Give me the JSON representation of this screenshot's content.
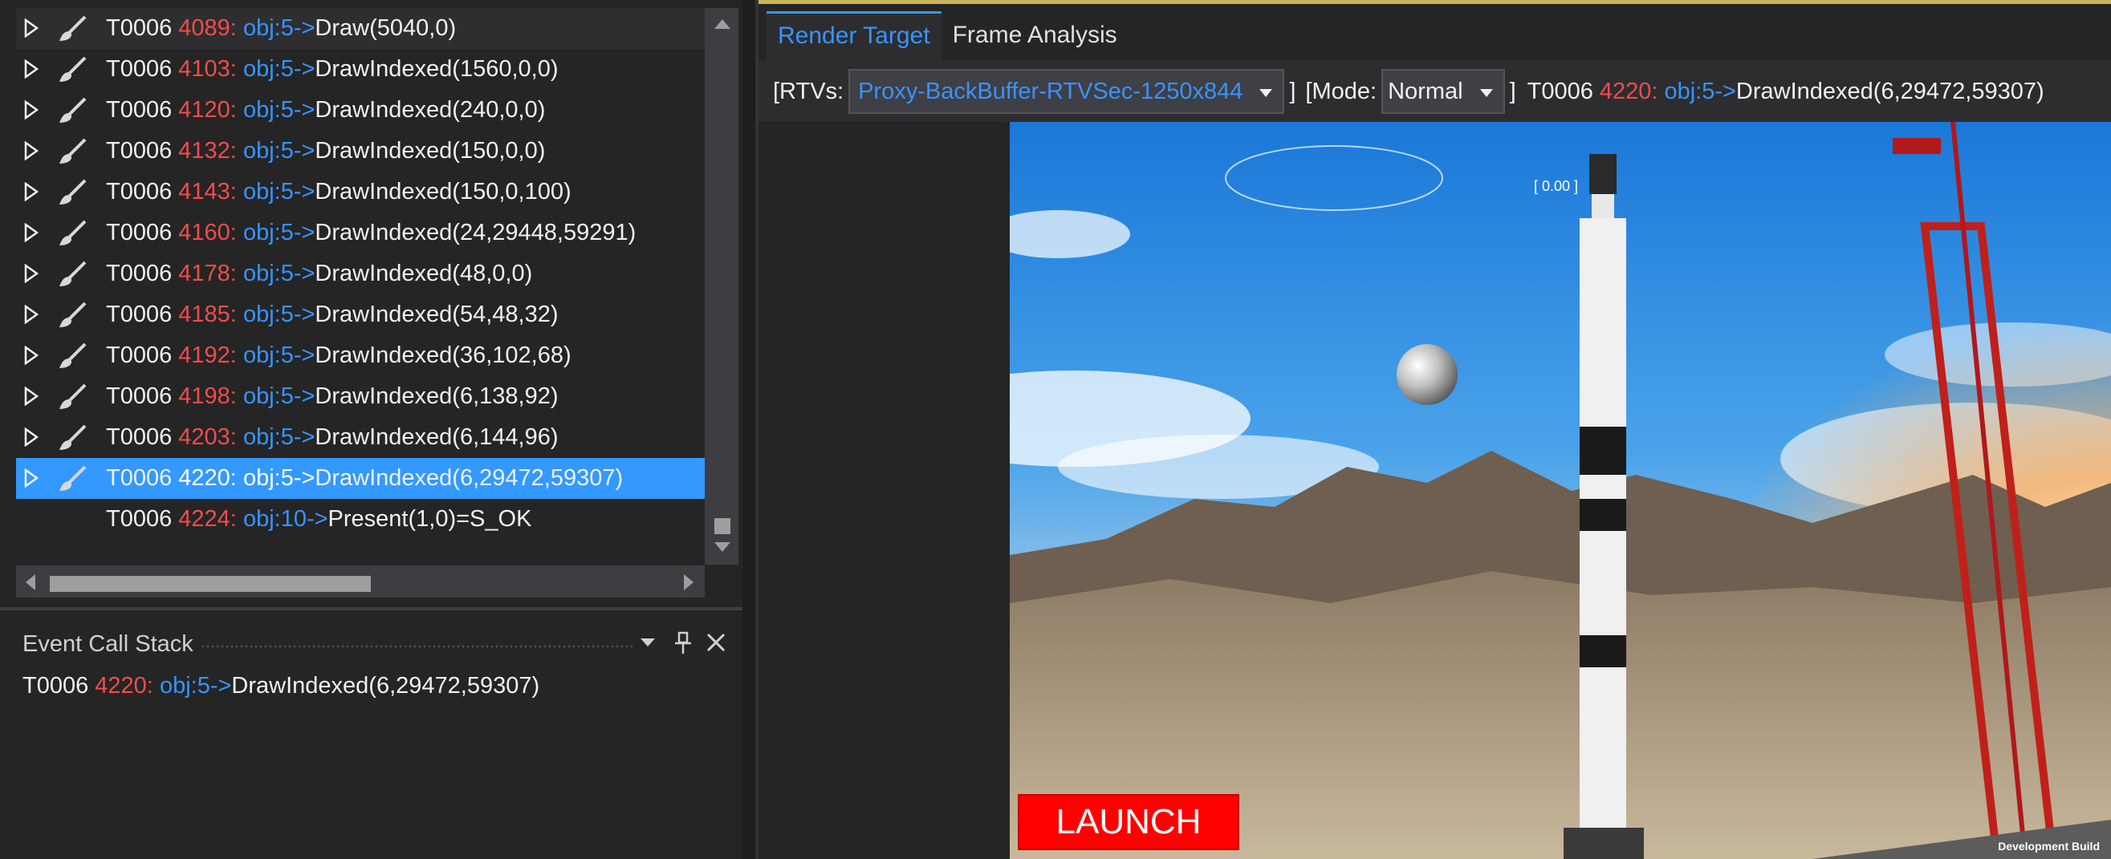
{
  "events": [
    {
      "thread": "T0006",
      "num": "4089:",
      "obj": "obj:5",
      "arrow": "->",
      "call": "Draw(5040,0)",
      "expandable": true,
      "icon": "brush-icon"
    },
    {
      "thread": "T0006",
      "num": "4103:",
      "obj": "obj:5",
      "arrow": "->",
      "call": "DrawIndexed(1560,0,0)",
      "expandable": true,
      "icon": "brush-icon"
    },
    {
      "thread": "T0006",
      "num": "4120:",
      "obj": "obj:5",
      "arrow": "->",
      "call": "DrawIndexed(240,0,0)",
      "expandable": true,
      "icon": "brush-icon"
    },
    {
      "thread": "T0006",
      "num": "4132:",
      "obj": "obj:5",
      "arrow": "->",
      "call": "DrawIndexed(150,0,0)",
      "expandable": true,
      "icon": "brush-icon"
    },
    {
      "thread": "T0006",
      "num": "4143:",
      "obj": "obj:5",
      "arrow": "->",
      "call": "DrawIndexed(150,0,100)",
      "expandable": true,
      "icon": "brush-icon"
    },
    {
      "thread": "T0006",
      "num": "4160:",
      "obj": "obj:5",
      "arrow": "->",
      "call": "DrawIndexed(24,29448,59291)",
      "expandable": true,
      "icon": "brush-icon"
    },
    {
      "thread": "T0006",
      "num": "4178:",
      "obj": "obj:5",
      "arrow": "->",
      "call": "DrawIndexed(48,0,0)",
      "expandable": true,
      "icon": "brush-icon"
    },
    {
      "thread": "T0006",
      "num": "4185:",
      "obj": "obj:5",
      "arrow": "->",
      "call": "DrawIndexed(54,48,32)",
      "expandable": true,
      "icon": "brush-icon"
    },
    {
      "thread": "T0006",
      "num": "4192:",
      "obj": "obj:5",
      "arrow": "->",
      "call": "DrawIndexed(36,102,68)",
      "expandable": true,
      "icon": "brush-icon"
    },
    {
      "thread": "T0006",
      "num": "4198:",
      "obj": "obj:5",
      "arrow": "->",
      "call": "DrawIndexed(6,138,92)",
      "expandable": true,
      "icon": "brush-icon"
    },
    {
      "thread": "T0006",
      "num": "4203:",
      "obj": "obj:5",
      "arrow": "->",
      "call": "DrawIndexed(6,144,96)",
      "expandable": true,
      "icon": "brush-icon"
    },
    {
      "thread": "T0006",
      "num": "4220:",
      "obj": "obj:5",
      "arrow": "->",
      "call": "DrawIndexed(6,29472,59307)",
      "expandable": true,
      "icon": "brush-icon",
      "selected": true
    },
    {
      "thread": "T0006",
      "num": "4224:",
      "obj": "obj:10",
      "arrow": "->",
      "call": "Present(1,0)=S_OK",
      "expandable": false,
      "icon": ""
    }
  ],
  "callstack": {
    "title": "Event Call Stack",
    "entry": {
      "thread": "T0006",
      "num": "4220:",
      "obj": "obj:5",
      "arrow": "->",
      "call": "DrawIndexed(6,29472,59307)"
    }
  },
  "tabs": [
    {
      "label": "Render Target",
      "active": true
    },
    {
      "label": "Frame Analysis",
      "active": false
    }
  ],
  "toolbar": {
    "rtvs_label": "[RTVs:",
    "rtv_value": "Proxy-BackBuffer-RTVSec-1250x844",
    "close_bracket_1": "]",
    "mode_label": "[Mode:",
    "mode_value": "Normal",
    "close_bracket_2": "]",
    "event": {
      "thread": "T0006",
      "num": "4220:",
      "obj": "obj:5",
      "arrow": "->",
      "call": "DrawIndexed(6,29472,59307)"
    }
  },
  "viewport": {
    "launch_label": "LAUNCH",
    "dev_build": "Development Build",
    "target_label": "[ 0.00 ]"
  },
  "colors": {
    "accent": "#3794ff",
    "event_number": "#f14c4c",
    "selection": "#3399ff",
    "launch": "#ff0000"
  }
}
